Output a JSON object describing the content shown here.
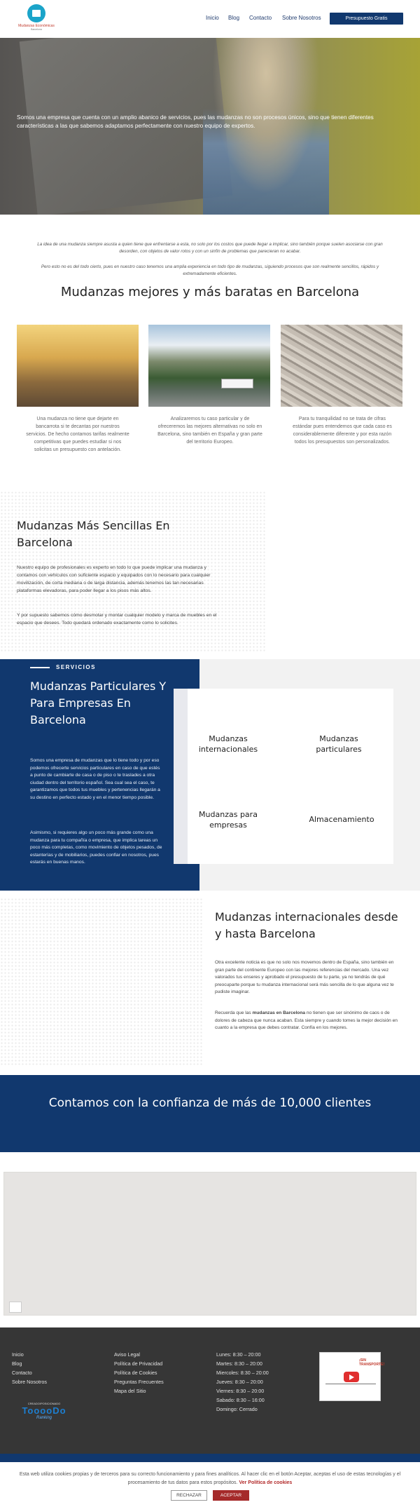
{
  "header": {
    "logo_text": "Mudanzas Económicas",
    "logo_sub": "Barcelona",
    "nav": [
      "Inicio",
      "Blog",
      "Contacto",
      "Sobre Nosotros"
    ],
    "cta": "Presupuesto Gratis"
  },
  "hero": {
    "text": "Somos una empresa que cuenta con un amplio abanico de servicios, pues las mudanzas no son procesos únicos, sino que tienen diferentes características a las que sabemos adaptamos perfectamente con nuestro equipo de expertos."
  },
  "intro": {
    "p1": "La idea de una mudanza siempre asusta a quien tiene que enfrentarse a esta, no solo por los costos que puede llegar a implicar, sino también porque suelen asociarse con gran desorden, con objetos de valor rotos y con un sinfín de problemas que parecieran no acabar.",
    "p2": "Pero esto no es del todo cierto, pues en nuestro caso tenemos una amplia experiencia en todo tipo de mudanzas, siguiendo procesos que son realmente sencillos, rápidos y extremadamente eficientes."
  },
  "main_title": "Mudanzas mejores y más baratas en Barcelona",
  "columns": [
    {
      "text": "Una mudanza no tiene que dejarte en bancarrota si te decantas por nuestros servicios. De hecho contamos tarifas realmente competitivas que puedes estudiar si nos solicitas un presupuesto con antelación."
    },
    {
      "text": "Analizaremos tu caso particular y de ofreceremos las mejores alternativas no solo en Barcelona, sino también en España y gran parte del territorio Europeo."
    },
    {
      "text": "Para tu tranquilidad no se trata de cifras estándar pues entendemos que cada caso es considerablemente diferente y por esta razón todos los presupuestos son personalizados."
    }
  ],
  "sencillas": {
    "title": "Mudanzas Más Sencillas En Barcelona",
    "p1": "Nuestro equipo de profesionales es experto en todo lo que puede implicar una mudanza y contamos con vehículos con suficiente espacio y equipados con lo necesario para cualquier movilización, de corta mediana o de larga distancia, además tenemos las tan necesarias plataformas elevadoras, para poder llegar a los pisos más altos.",
    "p2": "Y por supuesto sabemos cómo desmotar y montar cualquier modelo y marca de muebles en el espacio que desees. Todo quedará ordenado exactamente como lo solicites."
  },
  "services": {
    "label": "SERVICIOS",
    "title": "Mudanzas Particulares Y Para Empresas En Barcelona",
    "p1": "Somos una empresa de mudanzas que lo tiene todo y por eso podemos ofrecerte servicios particulares en caso de que estés a punto de cambiarte de casa o de piso o te traslades a otra ciudad dentro del territorio español. Sea cual sea el caso, te garantizamos que todos tus muebles y pertenencias llegarán a su destino en perfecto estado y en el menor tiempo posible.",
    "p2": "Asimismo, si requieres algo un poco más grande como una mudanza para tu compañía o empresa, que implica tareas un poco más completas, como movimiento de objetos pesados, de estanterías y de mobiliarios, puedes confiar en nosotros, pues estarás en buenas manos.",
    "items": [
      "Mudanzas internacionales",
      "Mudanzas particulares",
      "Mudanzas para empresas",
      "Almacenamiento"
    ]
  },
  "internacionales": {
    "title": "Mudanzas internacionales desde y hasta Barcelona",
    "p1": "Otra excelente noticia es que no solo nos movemos dentro de España, sino también en gran parte del continente Europeo con las mejores referencias del mercado. Una vez valorados tus enseres y aprobado el presupuesto de tu parte, ya no tendrás de qué preocuparte porque tu mudanza internacional será más sencilla de lo que alguna vez te pudiste imaginar.",
    "p2_pre": "Recuerda que las ",
    "p2_bold": "mudanzas en Barcelona",
    "p2_post": " no tienen que ser sinónimo de caos o de dolores de cabeza que nunca acaban. Esta siempre y cuando tomes la mejor decisión en cuanto a la empresa que debes contratar. Confía en los mejores."
  },
  "clients": "Contamos con la confianza de más de 10,000 clientes",
  "footer": {
    "col1": [
      "Inicio",
      "Blog",
      "Contacto",
      "Sobre Nosotros"
    ],
    "col2": [
      "Aviso Legal",
      "Política de Privacidad",
      "Política de Cookies",
      "Preguntas Frecuentes",
      "Mapa del Sitio"
    ],
    "hours": [
      "Lunes: 8:30 – 20:00",
      "Martes: 8:30 – 20:00",
      "Miercoles: 8:30 – 20:00",
      "Jueves: 8:30 – 20:00",
      "Viernes: 8:30 – 20:00",
      "Sabado: 8:30 – 16:00",
      "Domingo: Cerrado"
    ],
    "badge_top": "CREADO/POSICIONADO",
    "badge_main": "TooooDo",
    "badge_sub": "Ranking",
    "video_title": "¡SIN TRANSPORTE!"
  },
  "cookie": {
    "text": "Esta web utiliza cookies propias y de terceros para su correcto funcionamiento y para fines analíticos. Al hacer clic en el botón Aceptar, aceptas el uso de estas tecnologías y el procesamiento de tus datos para estos propósitos.",
    "link": "Ver Política de cookies",
    "reject": "RECHAZAR",
    "accept": "ACEPTAR"
  }
}
